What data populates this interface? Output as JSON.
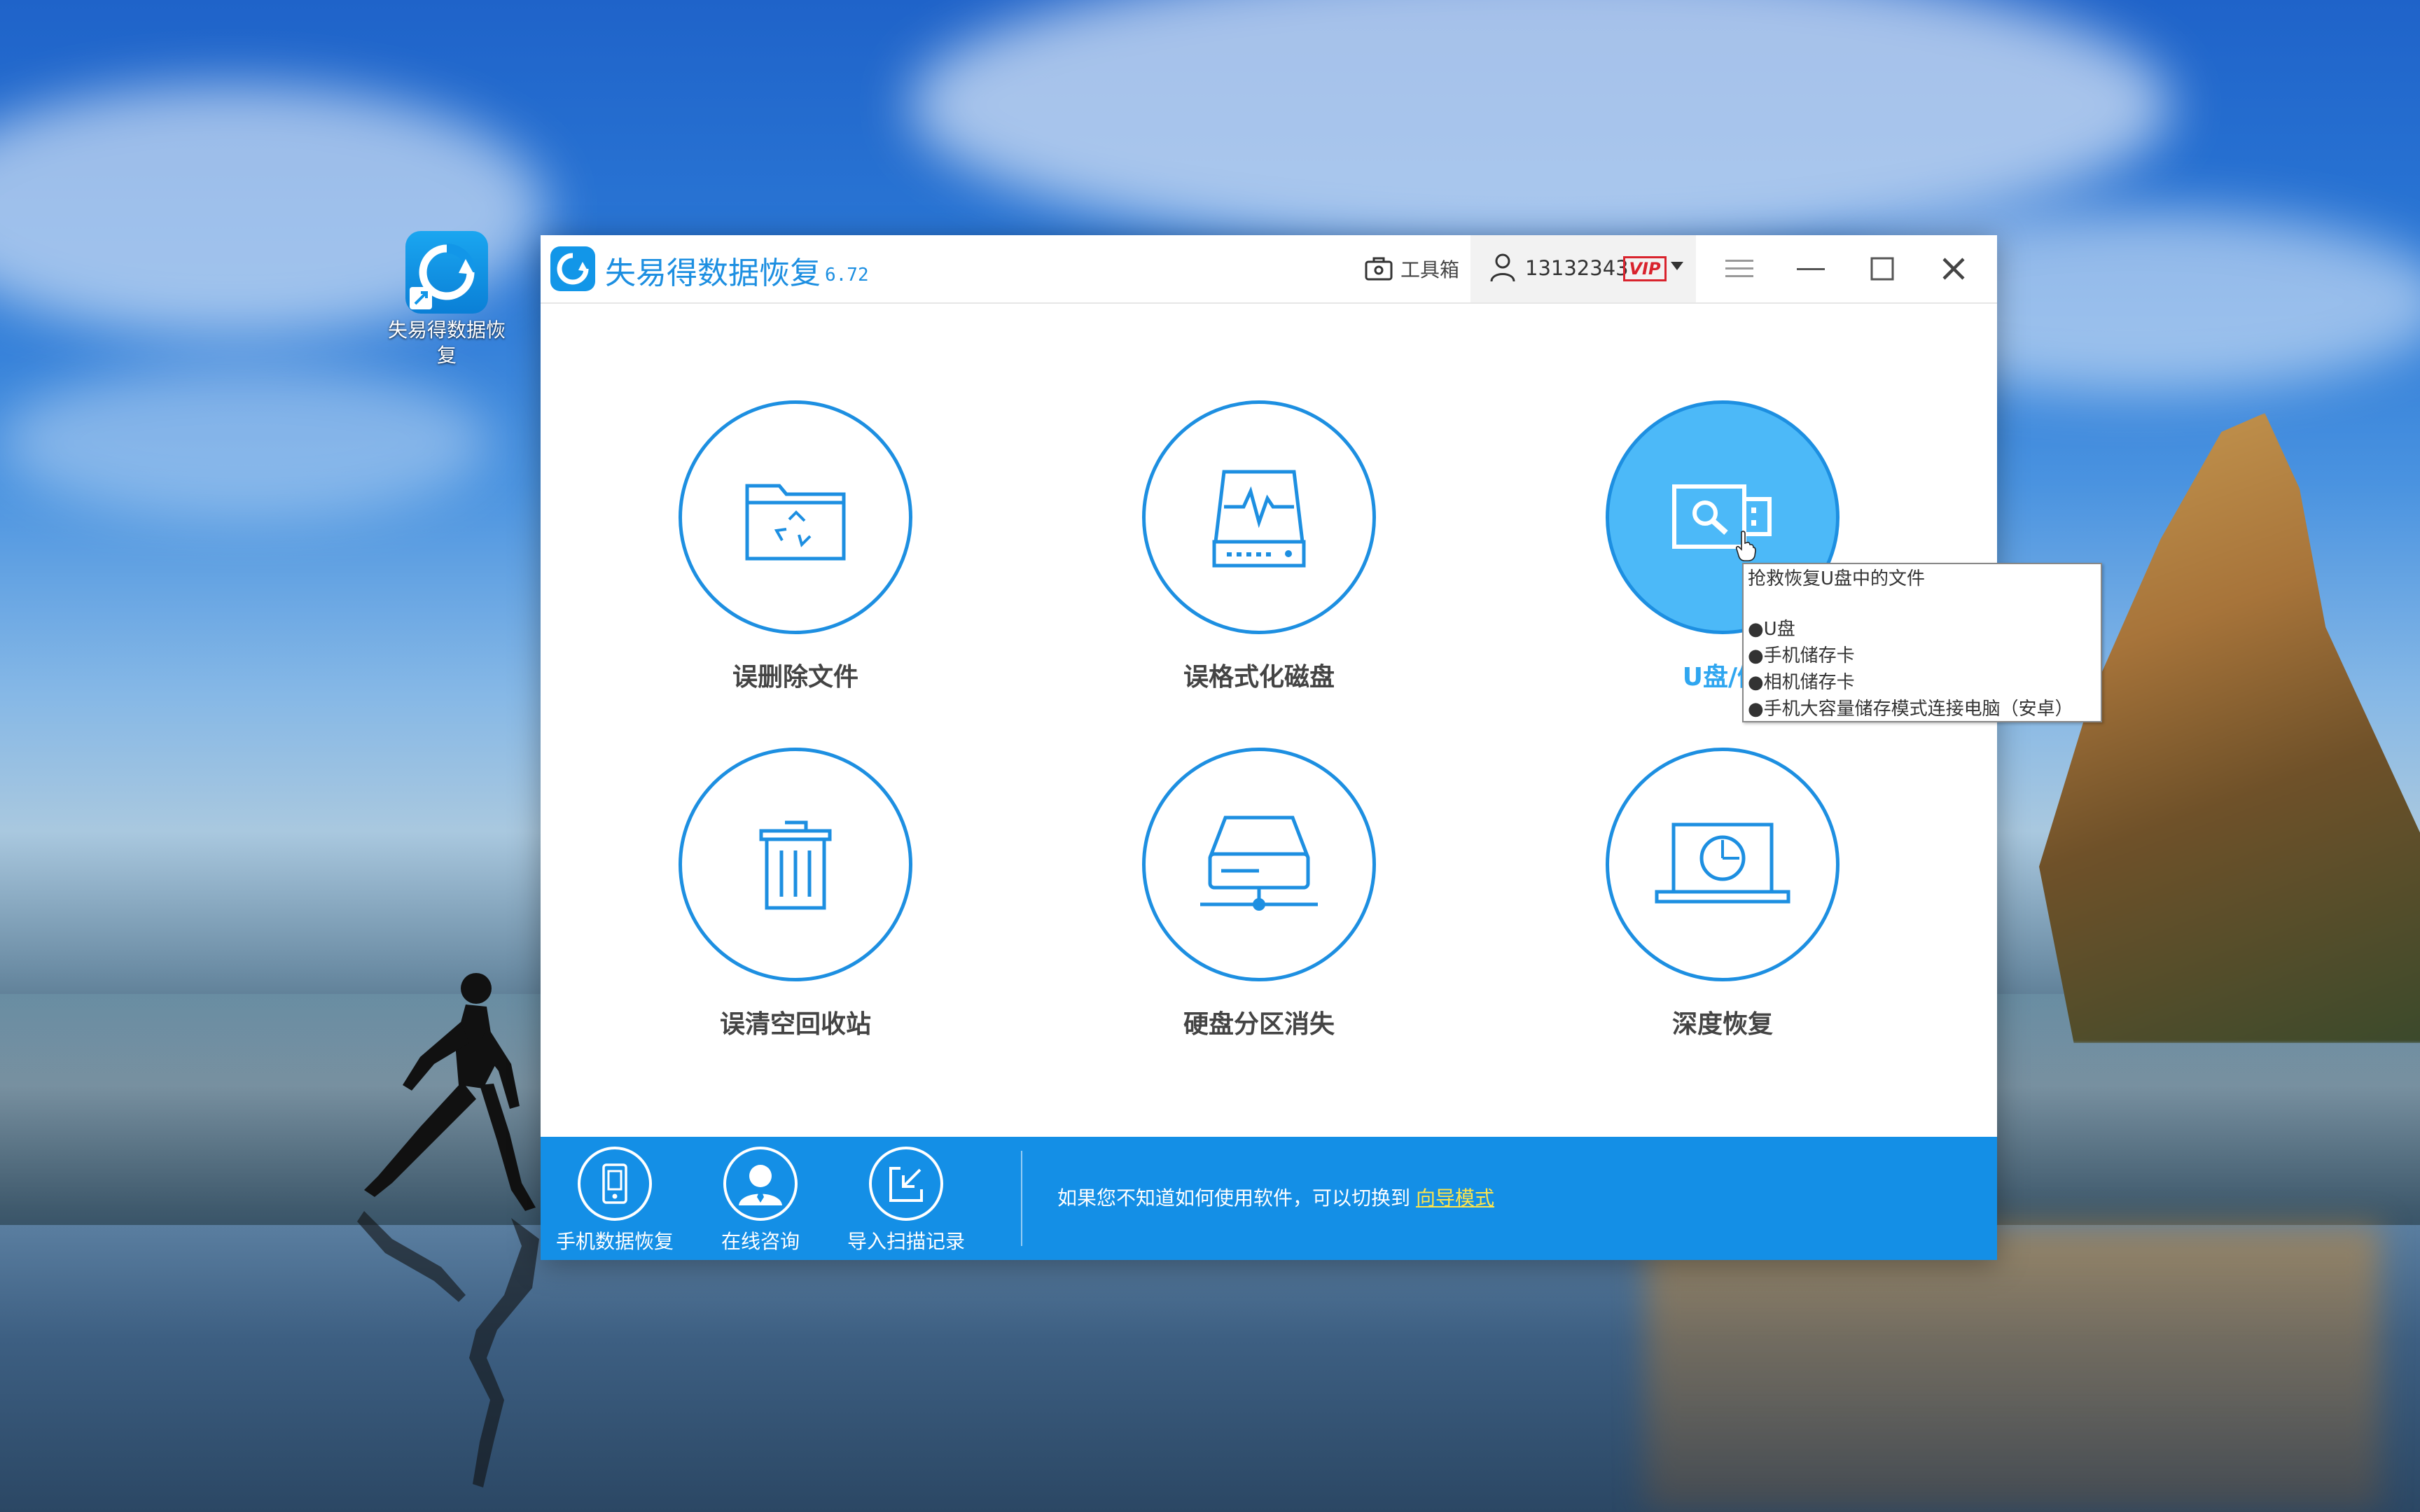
{
  "desktop": {
    "icon_label": "失易得数据恢复"
  },
  "app": {
    "title": "失易得数据恢复",
    "version": "6.72",
    "toolbox_label": "工具箱",
    "user_id": "13132343",
    "vip_label": "VIP"
  },
  "tiles": [
    {
      "label": "误删除文件",
      "icon": "folder-recycle-icon"
    },
    {
      "label": "误格式化磁盘",
      "icon": "disk-pulse-icon"
    },
    {
      "label": "U盘/储",
      "icon": "usb-search-icon"
    },
    {
      "label": "误清空回收站",
      "icon": "trash-bin-icon"
    },
    {
      "label": "硬盘分区消失",
      "icon": "network-drive-icon"
    },
    {
      "label": "深度恢复",
      "icon": "laptop-scan-icon"
    }
  ],
  "tooltip": {
    "title": "抢救恢复U盘中的文件",
    "items": [
      "●U盘",
      "●手机储存卡",
      "●相机储存卡",
      "●手机大容量储存模式连接电脑（安卓）"
    ]
  },
  "bottom": {
    "items": [
      {
        "label": "手机数据恢复",
        "icon": "phone-icon"
      },
      {
        "label": "在线咨询",
        "icon": "support-agent-icon"
      },
      {
        "label": "导入扫描记录",
        "icon": "import-icon"
      }
    ],
    "hint_text": "如果您不知道如何使用软件，可以切换到",
    "hint_link": "向导模式"
  },
  "colors": {
    "accent": "#1d8fe1",
    "bottom_bar": "#148fe6",
    "active_tile": "#4cb9f8",
    "vip_red": "#d9232d",
    "link_yellow": "#ffe54a"
  }
}
